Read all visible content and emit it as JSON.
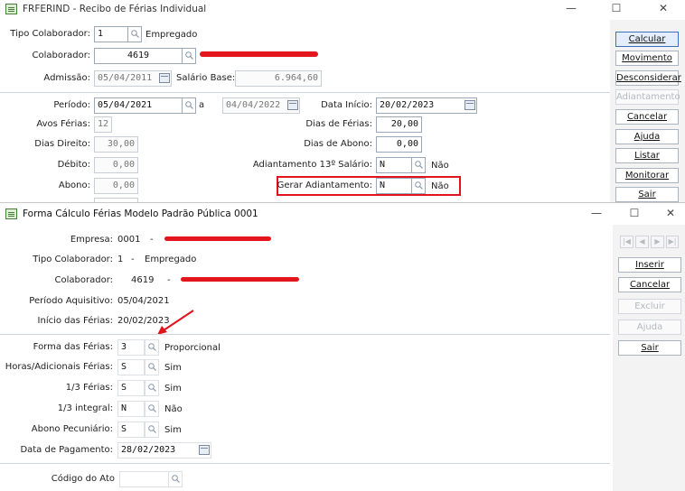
{
  "win1": {
    "title": "FRFERIND - Recibo de Férias Individual",
    "fields": {
      "tipo_colaborador_label": "Tipo Colaborador:",
      "tipo_colaborador_value": "1",
      "tipo_colaborador_desc": "Empregado",
      "colaborador_label": "Colaborador:",
      "colaborador_value": "4619",
      "admissao_label": "Admissão:",
      "admissao_value": "05/04/2011",
      "salario_base_label": "Salário Base:",
      "salario_base_value": "6.964,60",
      "periodo_label": "Período:",
      "periodo_inicio": "05/04/2021",
      "periodo_a": "a",
      "periodo_fim": "04/04/2022",
      "data_inicio_label": "Data Início:",
      "data_inicio_value": "20/02/2023",
      "avos_ferias_label": "Avos Férias:",
      "avos_ferias_value": "12",
      "dias_ferias_label": "Dias de Férias:",
      "dias_ferias_value": "20,00",
      "dias_direito_label": "Dias Direito:",
      "dias_direito_value": "30,00",
      "dias_abono_label": "Dias de Abono:",
      "dias_abono_value": "0,00",
      "debito_label": "Débito:",
      "debito_value": "0,00",
      "adiant13_label": "Adiantamento 13º Salário:",
      "adiant13_value": "N",
      "adiant13_desc": "Não",
      "abono_label": "Abono:",
      "abono_value": "0,00",
      "gerar_adiant_label": "Gerar Adiantamento:",
      "gerar_adiant_value": "N",
      "gerar_adiant_desc": "Não"
    },
    "buttons": {
      "calcular": "Calcular",
      "movimento": "Movimento",
      "desconsiderar": "Desconsiderar",
      "adiantamento": "Adiantamento",
      "cancelar": "Cancelar",
      "ajuda": "Ajuda",
      "listar": "Listar",
      "monitorar": "Monitorar",
      "sair": "Sair"
    }
  },
  "win2": {
    "title": "Forma Cálculo Férias Modelo Padrão Pública 0001",
    "info": {
      "empresa_label": "Empresa:",
      "empresa_value": "0001",
      "empresa_sep": "-",
      "tipo_colab_label": "Tipo Colaborador:",
      "tipo_colab_value": "1",
      "tipo_colab_sep": "-",
      "tipo_colab_desc": "Empregado",
      "colaborador_label": "Colaborador:",
      "colaborador_value": "4619",
      "colaborador_sep": "-",
      "periodo_aquisitivo_label": "Período Aquisitivo:",
      "periodo_aquisitivo_value": "05/04/2021",
      "inicio_ferias_label": "Início das Férias:",
      "inicio_ferias_value": "20/02/2023"
    },
    "form": {
      "forma_ferias_label": "Forma das Férias:",
      "forma_ferias_value": "3",
      "forma_ferias_desc": "Proporcional",
      "horas_label": "Horas/Adicionais Férias:",
      "horas_value": "S",
      "horas_desc": "Sim",
      "um_terco_label": "1/3 Férias:",
      "um_terco_value": "S",
      "um_terco_desc": "Sim",
      "um_terco_integral_label": "1/3 integral:",
      "um_terco_integral_value": "N",
      "um_terco_integral_desc": "Não",
      "abono_pec_label": "Abono Pecuniário:",
      "abono_pec_value": "S",
      "abono_pec_desc": "Sim",
      "data_pagamento_label": "Data de Pagamento:",
      "data_pagamento_value": "28/02/2023",
      "codigo_ato_label": "Código do Ato",
      "codigo_ato_value": ""
    },
    "buttons": {
      "inserir": "Inserir",
      "cancelar": "Cancelar",
      "excluir": "Excluir",
      "ajuda": "Ajuda",
      "sair": "Sair"
    }
  },
  "colors": {
    "redaction": "#e3151d",
    "highlight": "#e0141c",
    "primary_border": "#3f6fbf"
  }
}
